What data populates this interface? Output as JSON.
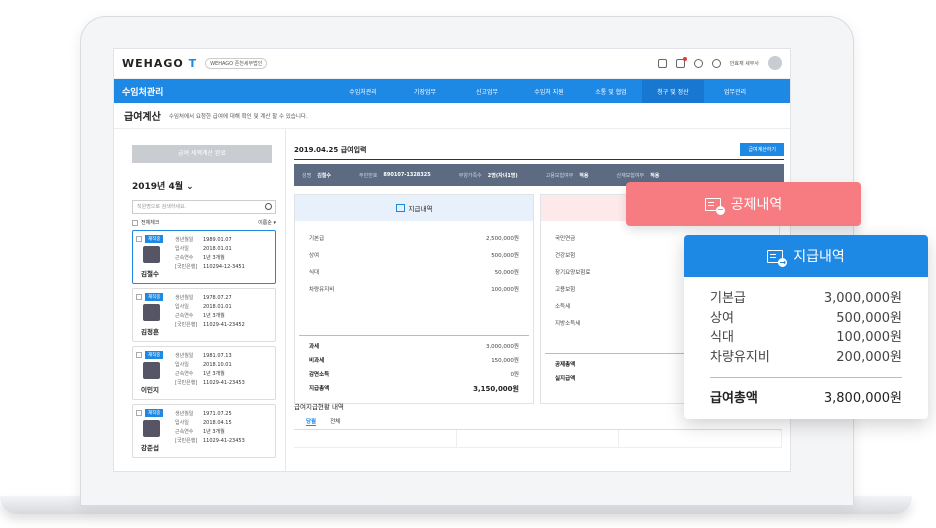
{
  "app": {
    "logo_text": "WEHAGO",
    "logo_suffix": "T",
    "org": "WEHAGO 존천세무법인",
    "user": "안효재 세무사"
  },
  "nav": {
    "title": "수임처관리",
    "items": [
      "수임처관리",
      "기장업무",
      "신고업무",
      "수임처 지원",
      "소통 및 협업",
      "청구 및 정산",
      "업무관리"
    ],
    "active_index": 5
  },
  "page": {
    "title": "급여계산",
    "desc": "수임처에서 요청한 급여에 대해 확인 및 계산 할 수 있습니다."
  },
  "left": {
    "complete_button": "급여 세액계산 완료",
    "month": "2019년 4월",
    "search_placeholder": "직원명으로 검색하세요.",
    "select_all": "전체체크",
    "sort": "이름순",
    "employees": [
      {
        "badge": "재직중",
        "name": "김철수",
        "birth_label": "생년월일",
        "birth": "1989.01.07",
        "join_label": "입사일",
        "join": "2018.01.01",
        "tenure_label": "근속연수",
        "tenure": "1년 3개월",
        "bank_label": "[국민은행]",
        "account": "110294-12-3451",
        "selected": true
      },
      {
        "badge": "재직중",
        "name": "김정훈",
        "birth_label": "생년월일",
        "birth": "1978.07.27",
        "join_label": "입사일",
        "join": "2018.01.01",
        "tenure_label": "근속연수",
        "tenure": "1년 3개월",
        "bank_label": "[국민은행]",
        "account": "11029-41-23452",
        "selected": false
      },
      {
        "badge": "재직중",
        "name": "이민지",
        "birth_label": "생년월일",
        "birth": "1981.07.13",
        "join_label": "입사일",
        "join": "2018.10.01",
        "tenure_label": "근속연수",
        "tenure": "1년 3개월",
        "bank_label": "[국민은행]",
        "account": "11029-41-23453",
        "selected": false
      },
      {
        "badge": "재직중",
        "name": "강준섭",
        "birth_label": "생년월일",
        "birth": "1971.07.25",
        "join_label": "입사일",
        "join": "2018.04.15",
        "tenure_label": "근속연수",
        "tenure": "1년 3개월",
        "bank_label": "[국민은행]",
        "account": "11029-41-23453",
        "selected": false
      }
    ]
  },
  "main": {
    "title": "2019.04.25 급여입력",
    "calc_button": "급여계산하기",
    "info": {
      "name_label": "성명",
      "name": "김철수",
      "id_label": "주민번호",
      "id": "890107-1328325",
      "family_label": "부양가족수",
      "family": "2명(자녀1명)",
      "emp_ins_label": "고용보험여부",
      "emp_ins": "적용",
      "labor_label": "산재보험여부",
      "labor": "적용"
    },
    "pay_card": {
      "title": "지급내역",
      "items": [
        {
          "label": "기본급",
          "value": "2,500,000원"
        },
        {
          "label": "상여",
          "value": "500,000원"
        },
        {
          "label": "식대",
          "value": "50,000원"
        },
        {
          "label": "차량유지비",
          "value": "100,000원"
        }
      ],
      "taxable_label": "과세",
      "taxable": "3,000,000원",
      "nontax_label": "비과세",
      "nontax": "150,000원",
      "reduce_label": "감면소득",
      "reduce": "0원",
      "total_label": "지급총액",
      "total": "3,150,000원"
    },
    "deduct_card": {
      "items": [
        "국민연금",
        "건강보험",
        "장기요양보험료",
        "고용보험",
        "소득세",
        "지방소득세"
      ],
      "total_label": "공제총액",
      "net_label": "실지급액"
    },
    "lower_title": "급여지급현황 내역",
    "tabs": [
      "당월",
      "전체"
    ]
  },
  "float_deduct": {
    "title": "공제내역"
  },
  "float_pay": {
    "title": "지급내역",
    "items": [
      {
        "label": "기본급",
        "value": "3,000,000원"
      },
      {
        "label": "상여",
        "value": "500,000원"
      },
      {
        "label": "식대",
        "value": "100,000원"
      },
      {
        "label": "차량유지비",
        "value": "200,000원"
      }
    ],
    "total_label": "급여총액",
    "total": "3,800,000원"
  },
  "colors": {
    "primary": "#1e88e5",
    "deduct": "#f77c82",
    "infobar": "#5c6b82"
  }
}
